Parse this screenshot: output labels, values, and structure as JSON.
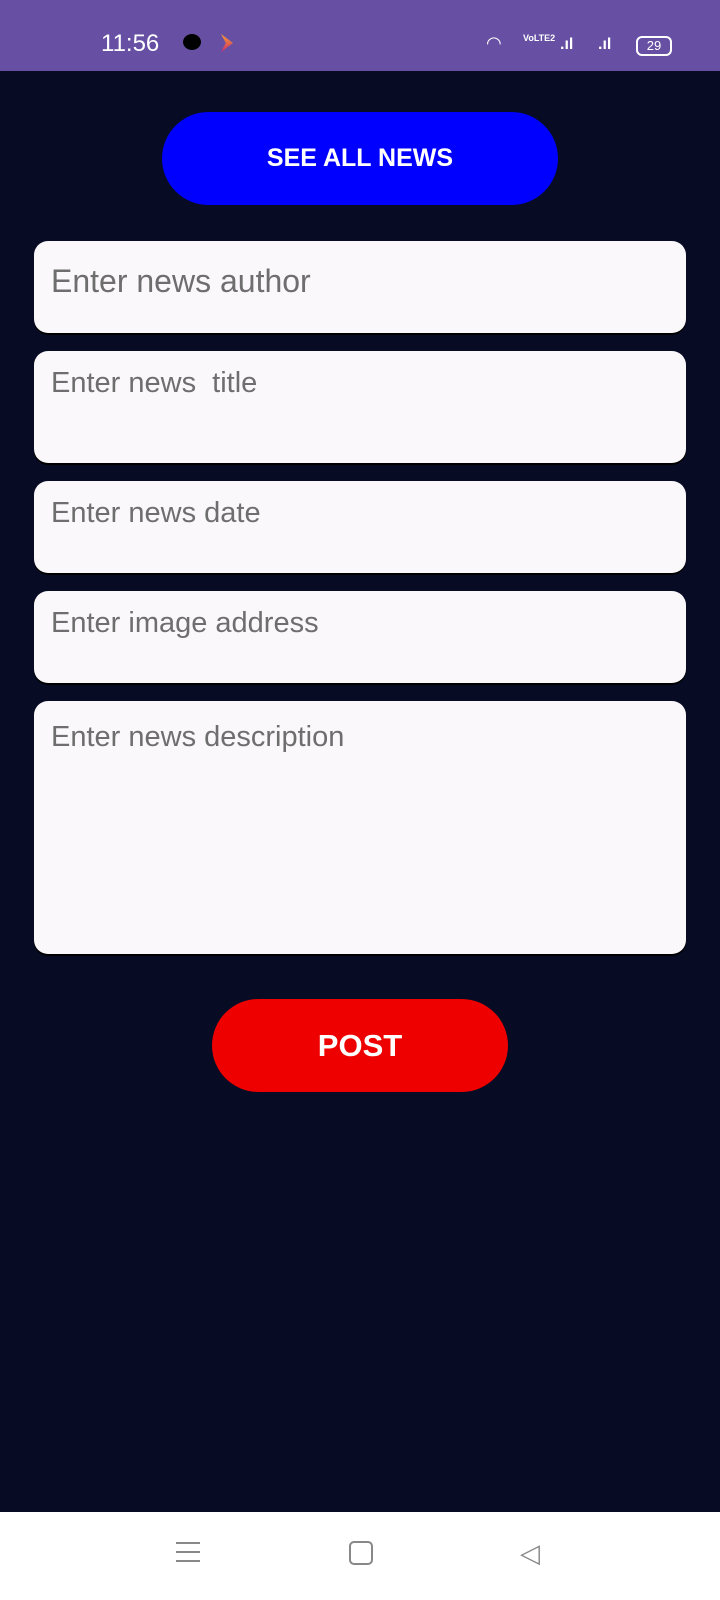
{
  "status_bar": {
    "time": "11:56",
    "battery": "29",
    "network": "VoLTE2"
  },
  "buttons": {
    "see_all_news": "SEE ALL NEWS",
    "post": "POST"
  },
  "fields": {
    "author": "Enter news author",
    "title": "Enter news  title",
    "date": "Enter news date",
    "image": "Enter image address",
    "description": "Enter news description"
  },
  "colors": {
    "status": "#6750a4",
    "background": "#080b24",
    "see_all": "#0000ff",
    "post": "#ef0000"
  }
}
